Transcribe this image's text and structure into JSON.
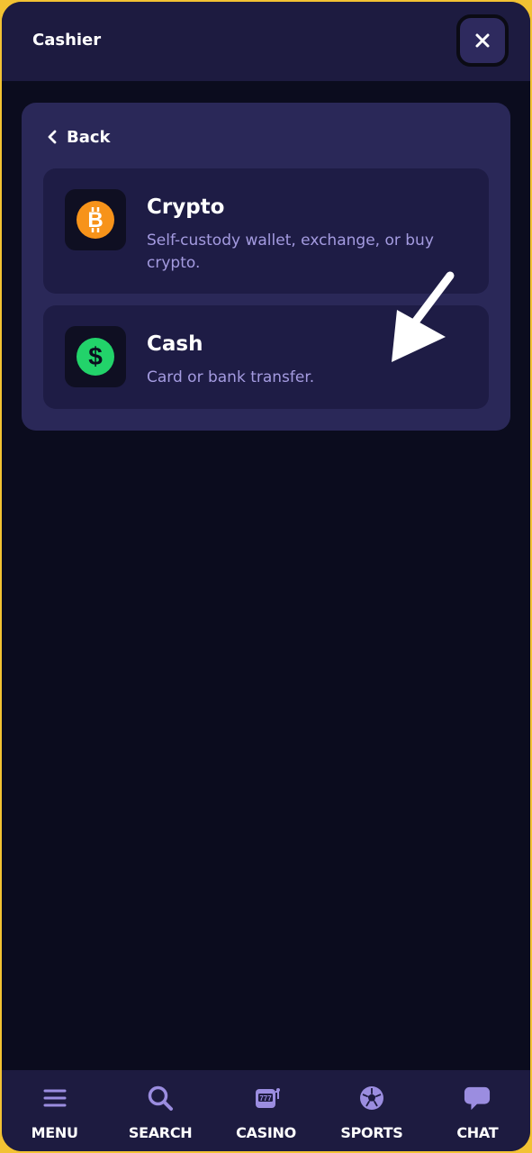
{
  "header": {
    "title": "Cashier"
  },
  "back": {
    "label": "Back"
  },
  "options": [
    {
      "title": "Crypto",
      "description": "Self-custody wallet, exchange, or buy crypto.",
      "icon": "bitcoin-icon",
      "icon_color": "#f7931a"
    },
    {
      "title": "Cash",
      "description": "Card or bank transfer.",
      "icon": "dollar-icon",
      "icon_color": "#22d36a"
    }
  ],
  "nav": [
    {
      "label": "MENU",
      "icon": "hamburger-icon"
    },
    {
      "label": "SEARCH",
      "icon": "search-icon"
    },
    {
      "label": "CASINO",
      "icon": "slot-machine-icon"
    },
    {
      "label": "SPORTS",
      "icon": "soccer-ball-icon"
    },
    {
      "label": "CHAT",
      "icon": "chat-bubble-icon"
    }
  ],
  "colors": {
    "accent": "#f2c233",
    "header_bg": "#1d1b40",
    "panel_bg": "#2a2858",
    "option_bg": "#1e1c45",
    "nav_icon": "#9b8de0"
  }
}
